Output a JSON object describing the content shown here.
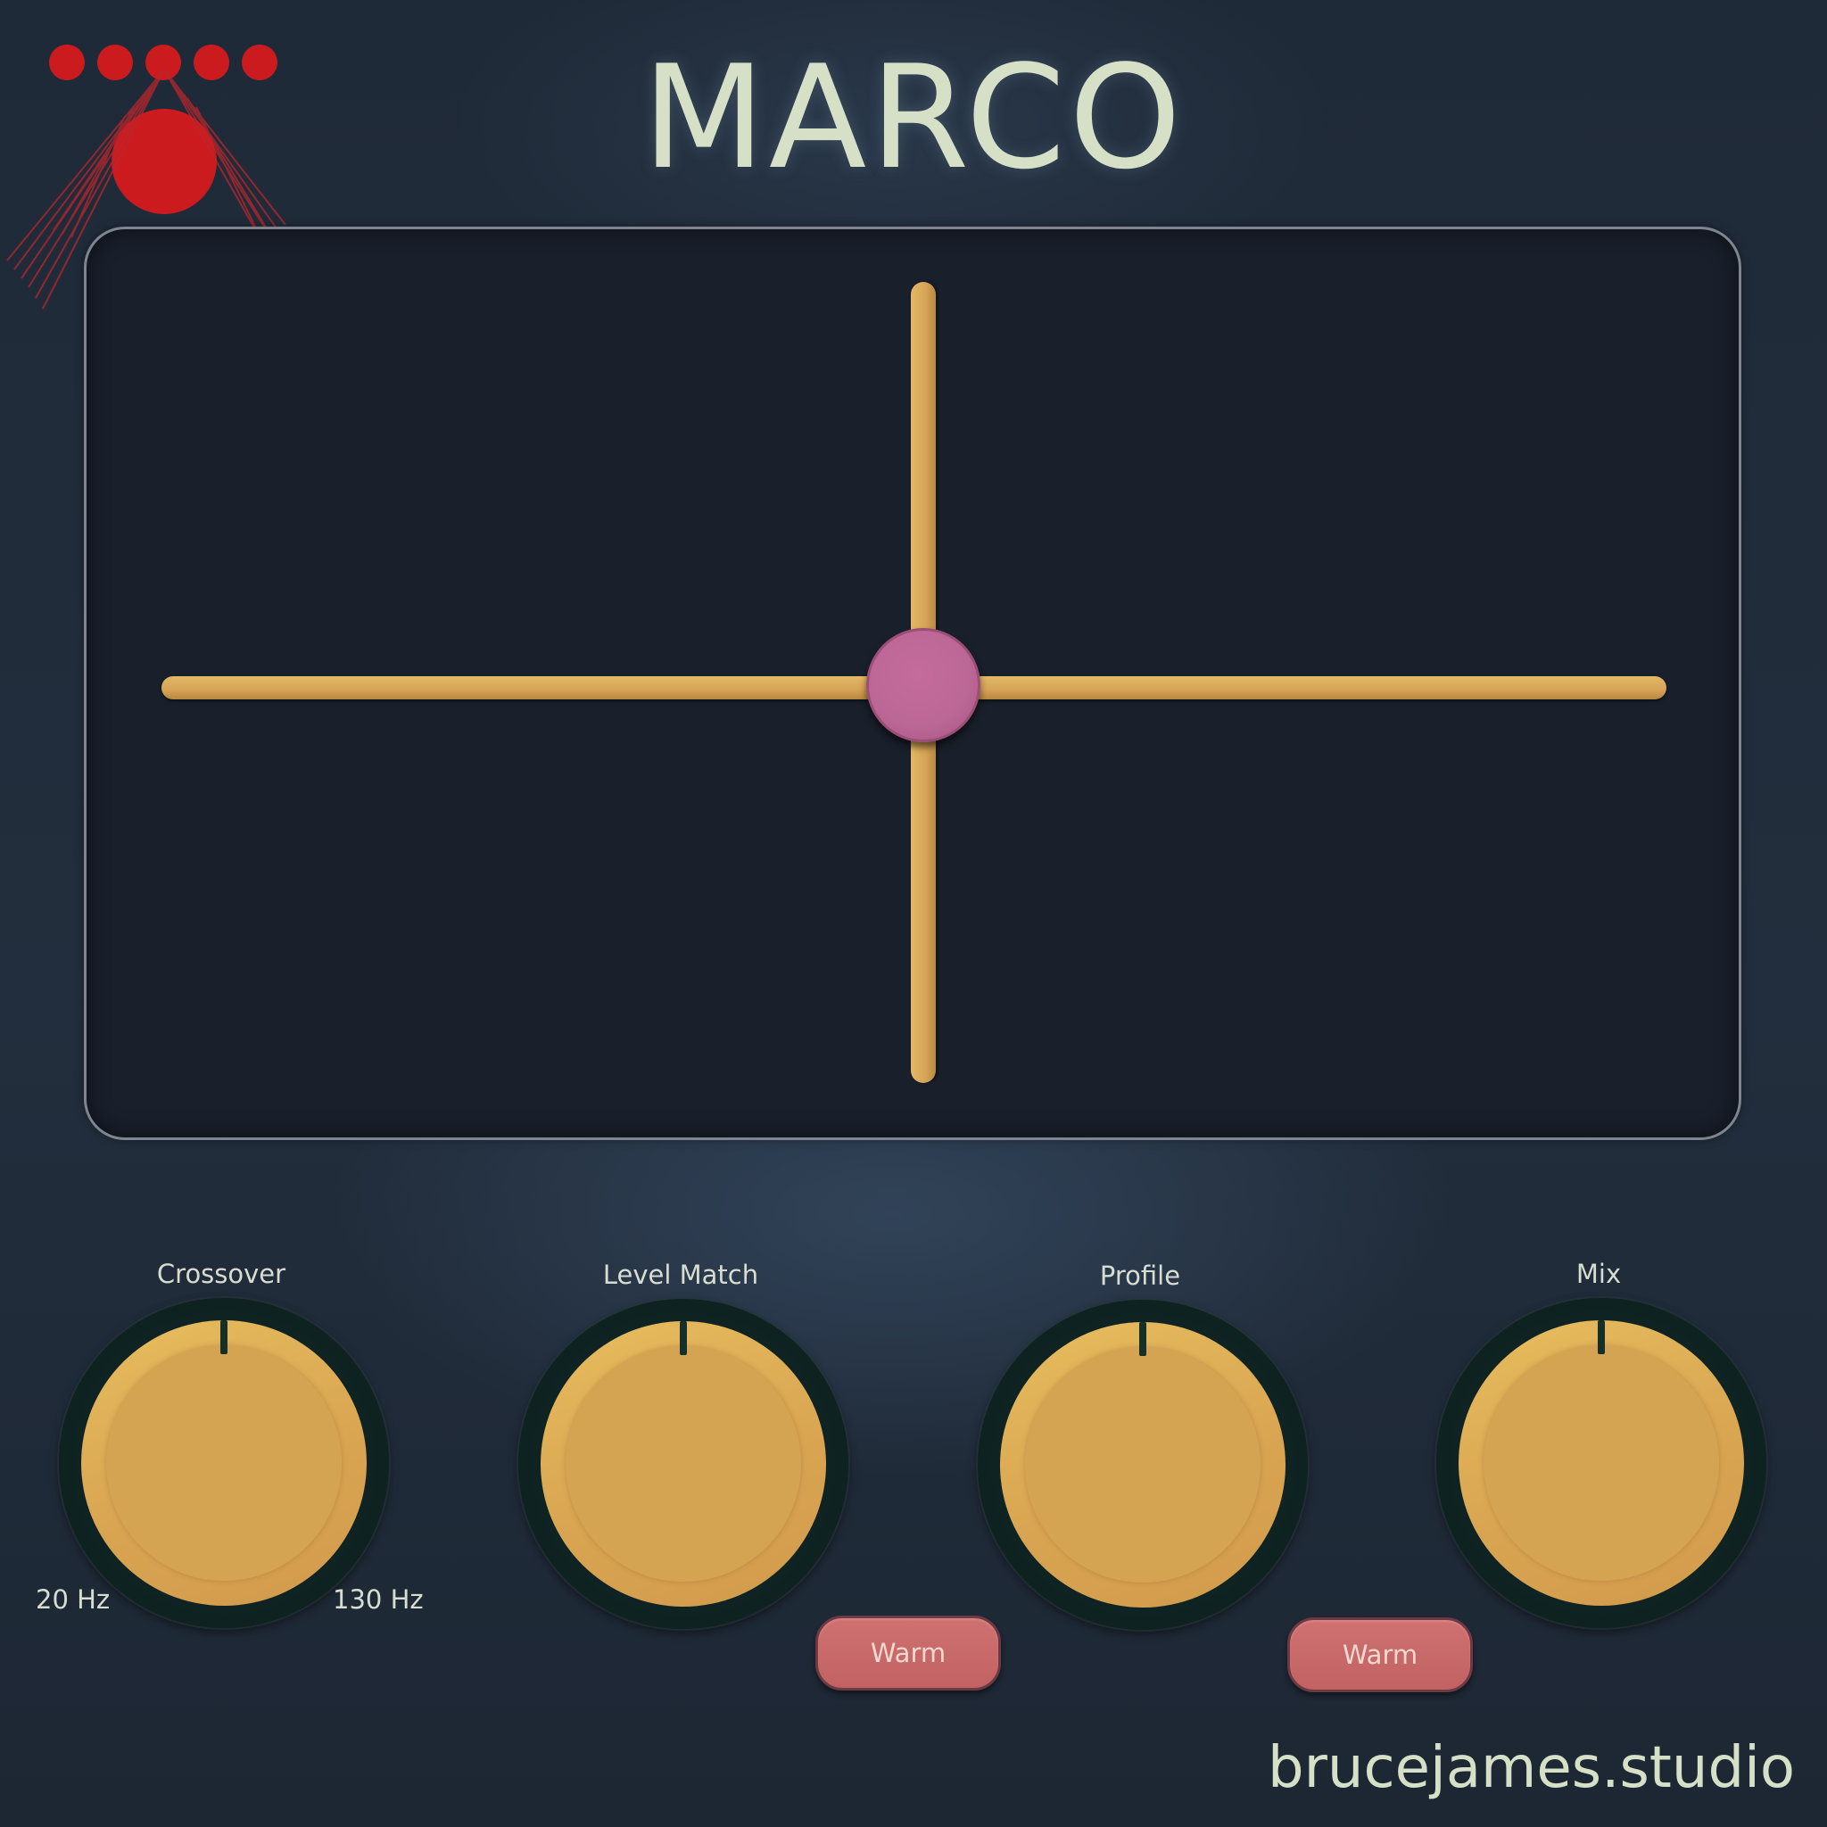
{
  "app": {
    "title": "MARCO",
    "website": "brucejames.studio"
  },
  "colors": {
    "background": "#222e3d",
    "pad": "#191f2b",
    "axis": "#d6a356",
    "handle": "#bb6796",
    "knob": "#d5a453",
    "knob_ring": "#0f2422",
    "button": "#c66868",
    "logo": "#cc1b1f",
    "text": "#d6e0c7"
  },
  "logo": {
    "icon": "red-dots-circle-logo-icon"
  },
  "xy_pad": {
    "handle_x": 0.5,
    "handle_y": 0.5
  },
  "knobs": [
    {
      "label": "Crossover",
      "min_label": "20 Hz",
      "max_label": "130 Hz",
      "position": 0.5
    },
    {
      "label": "Level Match",
      "position": 0.5
    },
    {
      "label": "Profile",
      "position": 0.5
    },
    {
      "label": "Mix",
      "position": 0.5
    }
  ],
  "buttons": [
    {
      "label": "Warm"
    },
    {
      "label": "Warm"
    }
  ]
}
